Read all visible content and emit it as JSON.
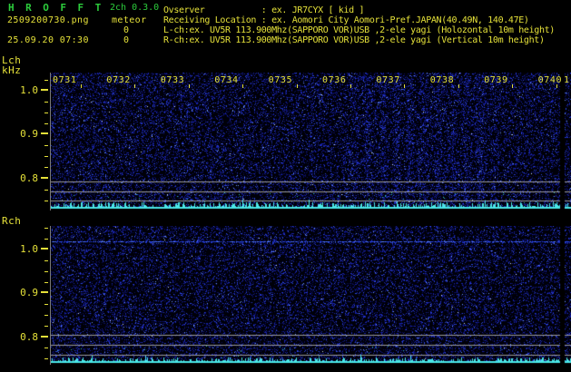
{
  "header": {
    "app_title": "HROFFT",
    "version": "2ch 0.3.0",
    "filename": "2509200730.png",
    "mode": "meteor",
    "echo_count_l": "0",
    "echo_count_r": "0",
    "datetime": "25.09.20 07:30",
    "info_lines": [
      "Ovserver           : ex. JR7CYX [ kid ]",
      "Receiving Location : ex. Aomori City Aomori-Pref.JAPAN(40.49N, 140.47E)",
      "L-ch:ex. UV5R 113.900Mhz(SAPPORO VOR)USB ,2-ele yagi (Holozontal 10m height)",
      "R-ch:ex. UV5R 113.900Mhz(SAPPORO VOR)USB ,2-ele yagi (Vertical 10m height)"
    ]
  },
  "colors": {
    "green": "#2ccd3c",
    "yellow": "#e5e139",
    "cyan": "#4ae8e8",
    "grid_gray": "#9a9a9a",
    "noise_blue": "#2035c8",
    "carrier_blue": "#4062e8",
    "background": "#000000"
  },
  "chart_data": [
    {
      "type": "heatmap",
      "panel": "L-ch spectrogram",
      "corner_label": "Lch",
      "ylabel": "kHz",
      "x_ticks": [
        "0731",
        "0732",
        "0733",
        "0734",
        "0735",
        "0736",
        "0737",
        "0738",
        "0739",
        "0740"
      ],
      "x_next_partial": "1",
      "y_ticks": [
        "1.0",
        "0.9",
        "0.8"
      ],
      "y_range_khz": [
        0.73,
        1.04
      ],
      "time_span": "07:30-07:40",
      "reference_lines_khz": [
        0.79,
        0.77,
        0.75
      ],
      "meteor_echo_count": 0,
      "features": [
        "dark blue background noise speckle",
        "vertical interference bands roughly between 0736 and 0739",
        "cyan noise-floor amplitude trace along panel bottom",
        "live-minute strip separated by black gap at right edge"
      ]
    },
    {
      "type": "heatmap",
      "panel": "R-ch spectrogram",
      "corner_label": "Rch",
      "ylabel": "",
      "x_ticks": [],
      "y_ticks": [
        "1.0",
        "0.9",
        "0.8"
      ],
      "y_range_khz": [
        0.73,
        1.04
      ],
      "time_span": "07:30-07:40",
      "carrier_line_khz": 1.02,
      "reference_lines_khz": [
        0.79,
        0.77,
        0.75
      ],
      "meteor_echo_count": 0,
      "features": [
        "continuous blue carrier line near 1.02 kHz",
        "dark blue background noise speckle",
        "cyan noise-floor amplitude trace along panel bottom",
        "live-minute strip separated by black gap at right edge"
      ]
    }
  ]
}
